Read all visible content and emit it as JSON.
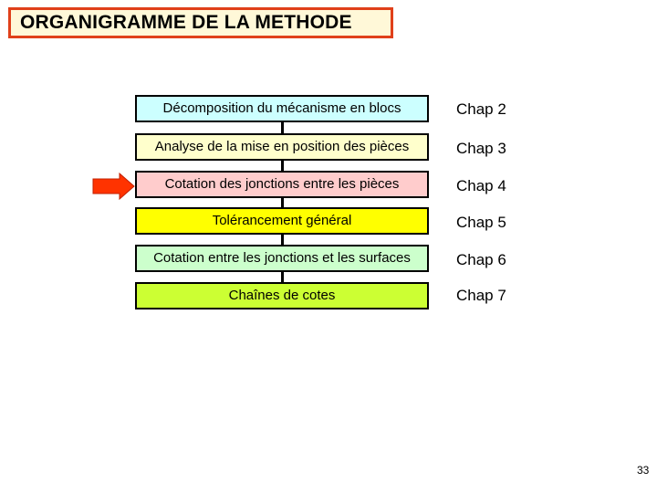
{
  "title": "ORGANIGRAMME DE LA METHODE",
  "steps": [
    {
      "label": "Décomposition du mécanisme en blocs",
      "chapter": "Chap 2",
      "color": "#ccffff"
    },
    {
      "label": "Analyse de la mise en position des pièces",
      "chapter": "Chap 3",
      "color": "#ffffcc"
    },
    {
      "label": "Cotation des jonctions entre les pièces",
      "chapter": "Chap 4",
      "color": "#ffcccc"
    },
    {
      "label": "Tolérancement général",
      "chapter": "Chap 5",
      "color": "#ffff00"
    },
    {
      "label": "Cotation entre les jonctions et les surfaces",
      "chapter": "Chap 6",
      "color": "#ccffcc"
    },
    {
      "label": "Chaînes de cotes",
      "chapter": "Chap 7",
      "color": "#ccff33"
    }
  ],
  "current_step_index": 2,
  "arrow_color": "#ff3300",
  "page_number": "33"
}
